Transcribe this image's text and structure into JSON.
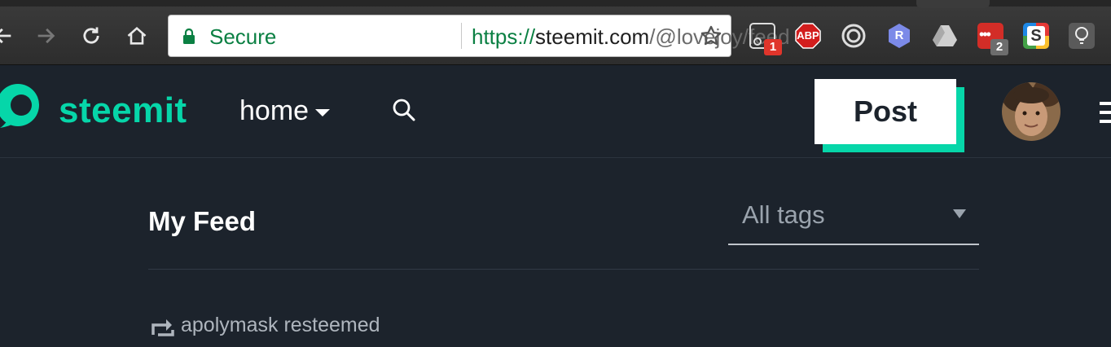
{
  "browser": {
    "address_bar": {
      "secure_label": "Secure",
      "url_scheme": "https://",
      "url_host": "steemit.com",
      "url_path": "/@lovejoy/feed"
    },
    "extensions": [
      {
        "name": "screenshot-extension",
        "badge": "1"
      },
      {
        "name": "adblock-plus",
        "label": "ABP"
      },
      {
        "name": "target-extension"
      },
      {
        "name": "r-extension",
        "label": "R"
      },
      {
        "name": "google-drive"
      },
      {
        "name": "lastpass",
        "badge": "2"
      },
      {
        "name": "s-extension",
        "label": "S"
      },
      {
        "name": "lightbulb-extension"
      }
    ]
  },
  "header": {
    "brand": "steemit",
    "home_label": "home",
    "post_label": "Post"
  },
  "feed": {
    "title": "My Feed",
    "tags_value": "All tags",
    "first_item": {
      "resteem_text": "apolymask resteemed"
    }
  },
  "colors": {
    "accent": "#06d6a9",
    "background": "#1c232c",
    "secure_green": "#0b8043"
  }
}
